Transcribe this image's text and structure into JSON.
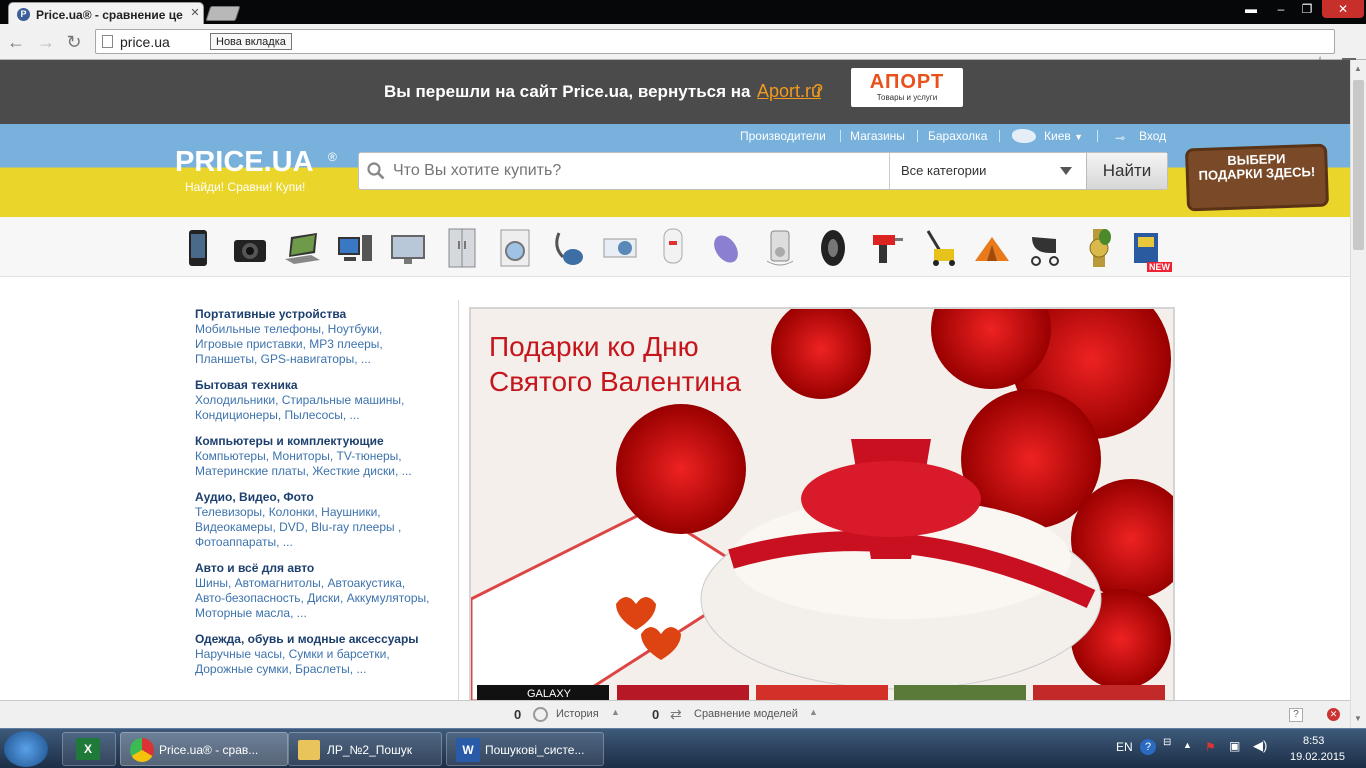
{
  "browser": {
    "tab_title": "Price.ua® - сравнение це",
    "favicon_letter": "P",
    "url": "price.ua",
    "tooltip": "Нова вкладка"
  },
  "aport_banner": {
    "text": "Вы перешли на сайт Price.ua, вернуться на",
    "link": "Aport.ru",
    "qmark": "?",
    "logo": "АПОРТ",
    "logo_sub": "Товары и услуги"
  },
  "header": {
    "logo": "PRICE.UA",
    "logo_reg": "®",
    "tagline": "Найди! Сравни! Купи!",
    "links": {
      "vendors": "Производители",
      "shops": "Магазины",
      "flea": "Барахолка",
      "city": "Киев",
      "login": "Вход"
    },
    "search_placeholder": "Что Вы хотите купить?",
    "category": "Все категории",
    "find": "Найти",
    "gift_sign": "ВЫБЕРИ ПОДАРКИ ЗДЕСЬ!",
    "new_badge": "NEW"
  },
  "category_icons": [
    "phone-icon",
    "camera-icon",
    "laptop-icon",
    "desktop-icon",
    "monitor-icon",
    "fridge-icon",
    "washer-icon",
    "vacuum-icon",
    "aircon-icon",
    "boiler-icon",
    "epilator-icon",
    "mp3-icon",
    "tire-icon",
    "drill-icon",
    "mower-icon",
    "tent-icon",
    "stroller-icon",
    "watch-icon",
    "book-icon"
  ],
  "menu": [
    {
      "title": "Портативные устройства",
      "links": [
        "Мобильные телефоны, Ноутбуки,",
        "Игровые приставки, MP3 плееры,",
        "Планшеты, GPS-навигаторы, ..."
      ]
    },
    {
      "title": "Бытовая техника",
      "links": [
        "Холодильники, Стиральные машины,",
        "Кондиционеры, Пылесосы, ..."
      ]
    },
    {
      "title": "Компьютеры и комплектующие",
      "links": [
        "Компьютеры, Мониторы, TV-тюнеры,",
        "Материнские платы, Жесткие диски, ..."
      ]
    },
    {
      "title": "Аудио, Видео, Фото",
      "links": [
        "Телевизоры, Колонки, Наушники,",
        "Видеокамеры, DVD, Blu-ray плееры ,",
        "Фотоаппараты, ..."
      ]
    },
    {
      "title": "Авто и всё для авто",
      "links": [
        "Шины, Автомагнитолы, Автоакустика,",
        "Авто-безопасность, Диски, Аккумуляторы,",
        "Моторные масла, ..."
      ]
    },
    {
      "title": "Одежда, обувь и модные аксессуары",
      "links": [
        "Наручные часы, Сумки и барсетки,",
        "Дорожные сумки, Браслеты, ..."
      ]
    }
  ],
  "promo": {
    "title_line1": "Подарки ко Дню",
    "title_line2": "Святого Валентина",
    "thumb1": "GALAXY"
  },
  "extbar": {
    "history_count": "0",
    "history": "История",
    "compare_count": "0",
    "compare": "Сравнение моделей",
    "help": "?"
  },
  "taskbar": {
    "items": [
      "Price.ua® - срав...",
      "ЛР_№2_Пошук",
      "Пошукові_систе..."
    ],
    "lang": "EN",
    "time": "8:53",
    "date": "19.02.2015"
  },
  "colors": {
    "flag_blue": "#78b1dc",
    "flag_yellow": "#ead62a",
    "link_blue": "#3d73ad",
    "promo_red": "#c4161c",
    "aport_orange": "#f39a1e"
  }
}
